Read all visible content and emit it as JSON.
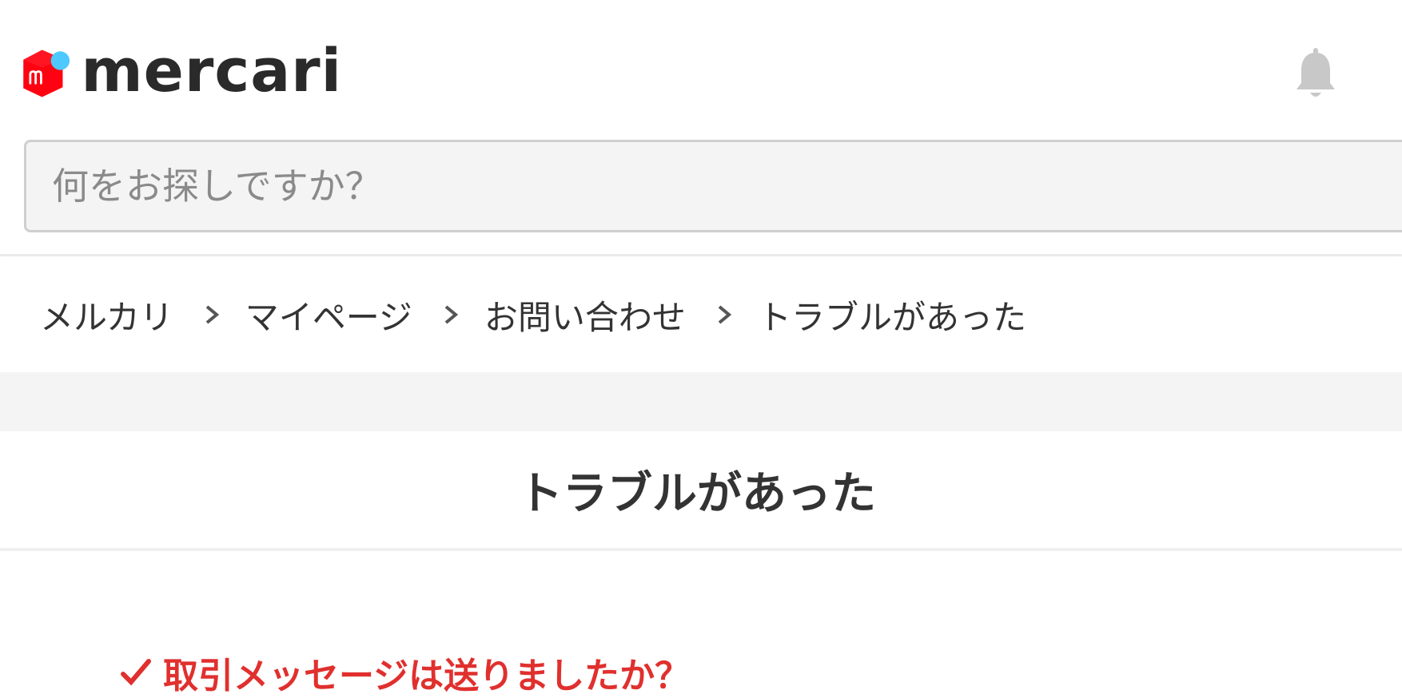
{
  "header": {
    "logo_text": "mercari",
    "search": {
      "placeholder": "何をお探しですか？",
      "value": ""
    }
  },
  "breadcrumb": {
    "items": [
      {
        "label": "メルカリ"
      },
      {
        "label": "マイページ"
      },
      {
        "label": "お問い合わせ"
      },
      {
        "label": "トラブルがあった"
      }
    ]
  },
  "main": {
    "title": "トラブルがあった",
    "question_label": "取引メッセージは送りましたか？"
  },
  "colors": {
    "brand_red": "#ff0211",
    "brand_blue": "#4dc9ff",
    "accent_red": "#e0302e",
    "text": "#333333",
    "background_gray": "#f5f4f4"
  },
  "icons": {
    "logo": "mercari-logo-icon",
    "notifications": "bell-icon",
    "breadcrumb_separator": "chevron-right-icon",
    "question_marker": "check-icon"
  }
}
